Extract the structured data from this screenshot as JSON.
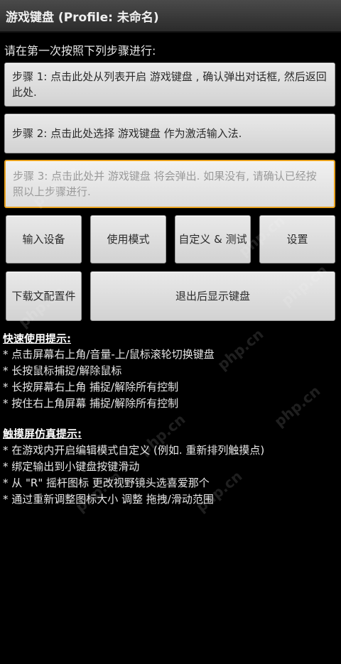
{
  "title": "游戏键盘 (Profile: 未命名)",
  "instruction": "请在第一次按照下列步骤进行:",
  "steps": [
    "步骤 1: 点击此处从列表开启 游戏键盘 , 确认弹出对话框, 然后返回此处.",
    "步骤 2: 点击此处选择 游戏键盘 作为激活输入法.",
    "步骤 3: 点击此处并 游戏键盘 将会弹出. 如果没有, 请确认已经按照以上步骤进行."
  ],
  "buttons": {
    "input_device": "输入设备",
    "use_mode": "使用模式",
    "customize_test": "自定义 & 测试",
    "settings": "设置",
    "download_config": "下载文配置件",
    "exit_show_keyboard": "退出后显示键盘"
  },
  "quick_tips": {
    "title": "快速使用提示:",
    "items": [
      "* 点击屏幕右上角/音量-上/鼠标滚轮切换键盘",
      "* 长按鼠标捕捉/解除鼠标",
      "* 长按屏幕右上角 捕捉/解除所有控制",
      "* 按住右上角屏幕 捕捉/解除所有控制"
    ]
  },
  "touch_tips": {
    "title": "触摸屏仿真提示:",
    "items": [
      "* 在游戏内开启编辑模式自定义 (例如. 重新排列触摸点)",
      "* 绑定输出到小键盘按键滑动",
      "* 从 \"R\" 摇杆图标 更改视野镜头选喜爱那个",
      "* 通过重新调整图标大小 调整 拖拽/滑动范围"
    ]
  },
  "watermark_text": "php.cn"
}
